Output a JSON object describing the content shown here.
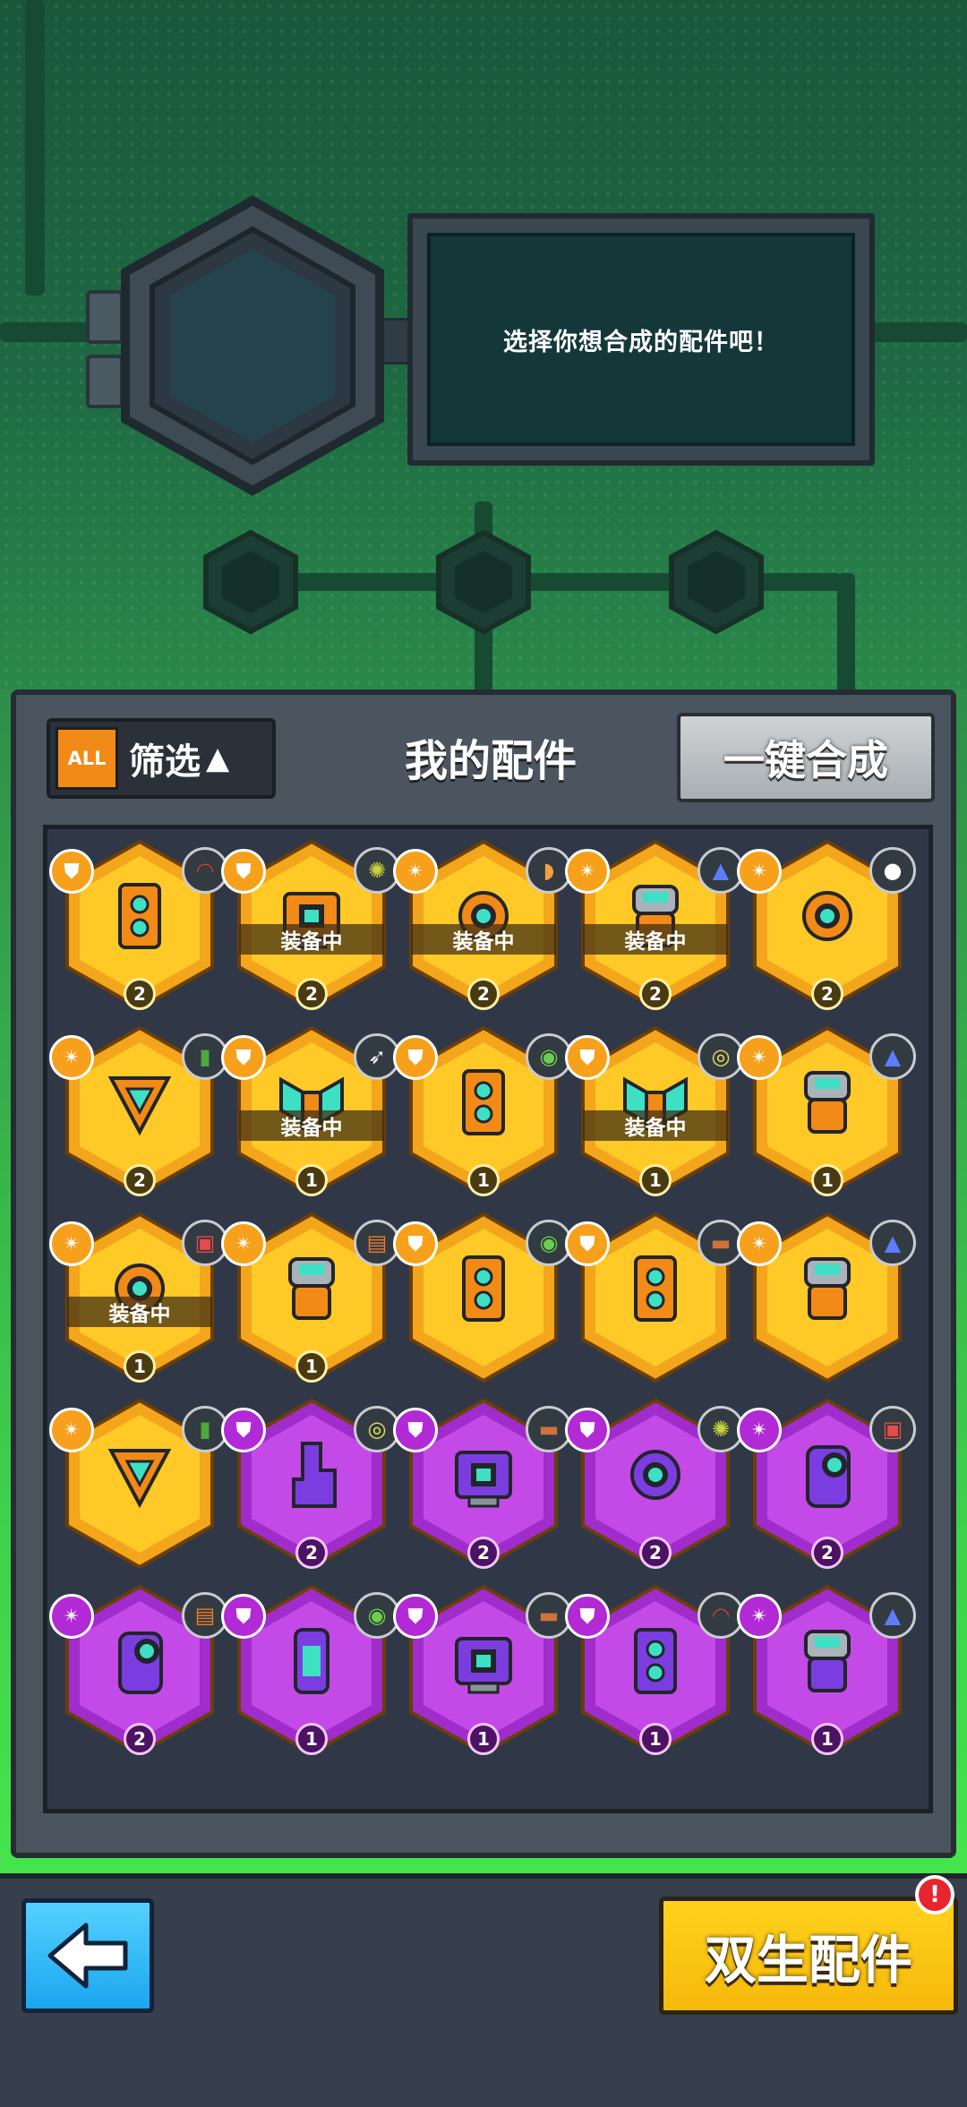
{
  "synthesis": {
    "prompt": "选择你想合成的配件吧！"
  },
  "inventory": {
    "filter": {
      "tag": "ALL",
      "label": "筛选",
      "arrow": "▲"
    },
    "title": "我的配件",
    "merge_all_label": "一键合成",
    "equipped_label": "装备中",
    "items": [
      {
        "rarity": "gold",
        "type": "shield",
        "element": "red-arc",
        "part": "body",
        "equipped": false,
        "level": "2"
      },
      {
        "rarity": "gold",
        "type": "shield",
        "element": "spore",
        "part": "camera",
        "equipped": true,
        "level": "2"
      },
      {
        "rarity": "gold",
        "type": "claw",
        "element": "horn",
        "part": "eye-wing",
        "equipped": true,
        "level": "2"
      },
      {
        "rarity": "gold",
        "type": "claw",
        "element": "cone",
        "part": "pod",
        "equipped": true,
        "level": "2"
      },
      {
        "rarity": "gold",
        "type": "claw",
        "element": "ball",
        "part": "eye-orb",
        "equipped": false,
        "level": "2"
      },
      {
        "rarity": "gold",
        "type": "claw",
        "element": "bottle",
        "part": "triangle",
        "equipped": false,
        "level": "2"
      },
      {
        "rarity": "gold",
        "type": "shield",
        "element": "rocket",
        "part": "wings",
        "equipped": true,
        "level": "1"
      },
      {
        "rarity": "gold",
        "type": "shield",
        "element": "melon",
        "part": "bracket",
        "equipped": false,
        "level": "1"
      },
      {
        "rarity": "gold",
        "type": "shield",
        "element": "target",
        "part": "frame",
        "equipped": true,
        "level": "1"
      },
      {
        "rarity": "gold",
        "type": "claw",
        "element": "cone",
        "part": "pod",
        "equipped": false,
        "level": "1"
      },
      {
        "rarity": "gold",
        "type": "claw",
        "element": "battery",
        "part": "dome",
        "equipped": true,
        "level": "1"
      },
      {
        "rarity": "gold",
        "type": "claw",
        "element": "card",
        "part": "cup",
        "equipped": false,
        "level": "1"
      },
      {
        "rarity": "gold",
        "type": "shield",
        "element": "melon",
        "part": "bracket",
        "equipped": false,
        "level": ""
      },
      {
        "rarity": "gold",
        "type": "shield",
        "element": "brick",
        "part": "body",
        "equipped": false,
        "level": ""
      },
      {
        "rarity": "gold",
        "type": "claw",
        "element": "cone",
        "part": "pod",
        "equipped": false,
        "level": ""
      },
      {
        "rarity": "gold",
        "type": "claw",
        "element": "bottle",
        "part": "triangle",
        "equipped": false,
        "level": ""
      },
      {
        "rarity": "purple",
        "type": "shield",
        "element": "target",
        "part": "fin",
        "equipped": false,
        "level": "2"
      },
      {
        "rarity": "purple",
        "type": "shield",
        "element": "brick",
        "part": "monitor",
        "equipped": false,
        "level": "2"
      },
      {
        "rarity": "purple",
        "type": "shield",
        "element": "spore",
        "part": "bot",
        "equipped": false,
        "level": "2"
      },
      {
        "rarity": "purple",
        "type": "claw",
        "element": "battery",
        "part": "cannon",
        "equipped": false,
        "level": "2"
      },
      {
        "rarity": "purple",
        "type": "claw",
        "element": "card",
        "part": "visor",
        "equipped": false,
        "level": "2"
      },
      {
        "rarity": "purple",
        "type": "shield",
        "element": "melon",
        "part": "tube",
        "equipped": false,
        "level": "1"
      },
      {
        "rarity": "purple",
        "type": "shield",
        "element": "brick",
        "part": "monitor",
        "equipped": false,
        "level": "1"
      },
      {
        "rarity": "purple",
        "type": "shield",
        "element": "red-arc",
        "part": "body",
        "equipped": false,
        "level": "1"
      },
      {
        "rarity": "purple",
        "type": "claw",
        "element": "cone",
        "part": "pod",
        "equipped": false,
        "level": "1"
      }
    ]
  },
  "footer": {
    "twin_parts_label": "双生配件",
    "alert": "!"
  },
  "colors": {
    "gold_outer": "#f3a51c",
    "gold_inner": "#ffc928",
    "purple_outer": "#a02ccc",
    "purple_inner": "#c34ae6",
    "accent_orange": "#f28a17",
    "accent_cyan": "#3ee0c4"
  }
}
